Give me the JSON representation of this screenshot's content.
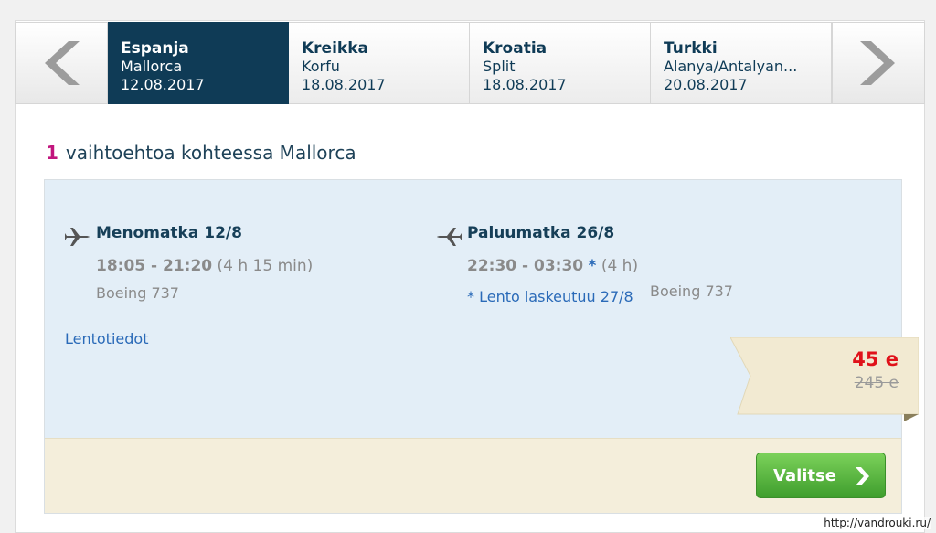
{
  "tabs": [
    {
      "country": "Espanja",
      "destination": "Mallorca",
      "date": "12.08.2017",
      "active": true
    },
    {
      "country": "Kreikka",
      "destination": "Korfu",
      "date": "18.08.2017",
      "active": false
    },
    {
      "country": "Kroatia",
      "destination": "Split",
      "date": "18.08.2017",
      "active": false
    },
    {
      "country": "Turkki",
      "destination": "Alanya/Antalyan...",
      "date": "20.08.2017",
      "active": false
    }
  ],
  "results": {
    "count": "1",
    "text": "vaihtoehtoa kohteessa Mallorca"
  },
  "outbound": {
    "title": "Menomatka 12/8",
    "times": "18:05 - 21:20",
    "duration": "(4 h 15 min)",
    "aircraft": "Boeing 737"
  },
  "return": {
    "title": "Paluumatka 26/8",
    "times": "22:30 - 03:30",
    "star": "*",
    "duration": "(4 h)",
    "note": "* Lento laskeutuu 27/8",
    "aircraft": "Boeing 737"
  },
  "details_link": "Lentotiedot",
  "price": {
    "current": "45 e",
    "original": "245 e"
  },
  "select_button": "Valitse",
  "watermark": "http://vandrouki.ru/",
  "colors": {
    "active_tab": "#0f3b56",
    "count": "#c1157d",
    "price": "#e0121a",
    "button": "#4cad36",
    "link": "#2a6ab8"
  },
  "icons": [
    "chevron-left-icon",
    "chevron-right-icon",
    "airplane-outbound-icon",
    "airplane-return-icon",
    "chevron-right-small-icon"
  ]
}
